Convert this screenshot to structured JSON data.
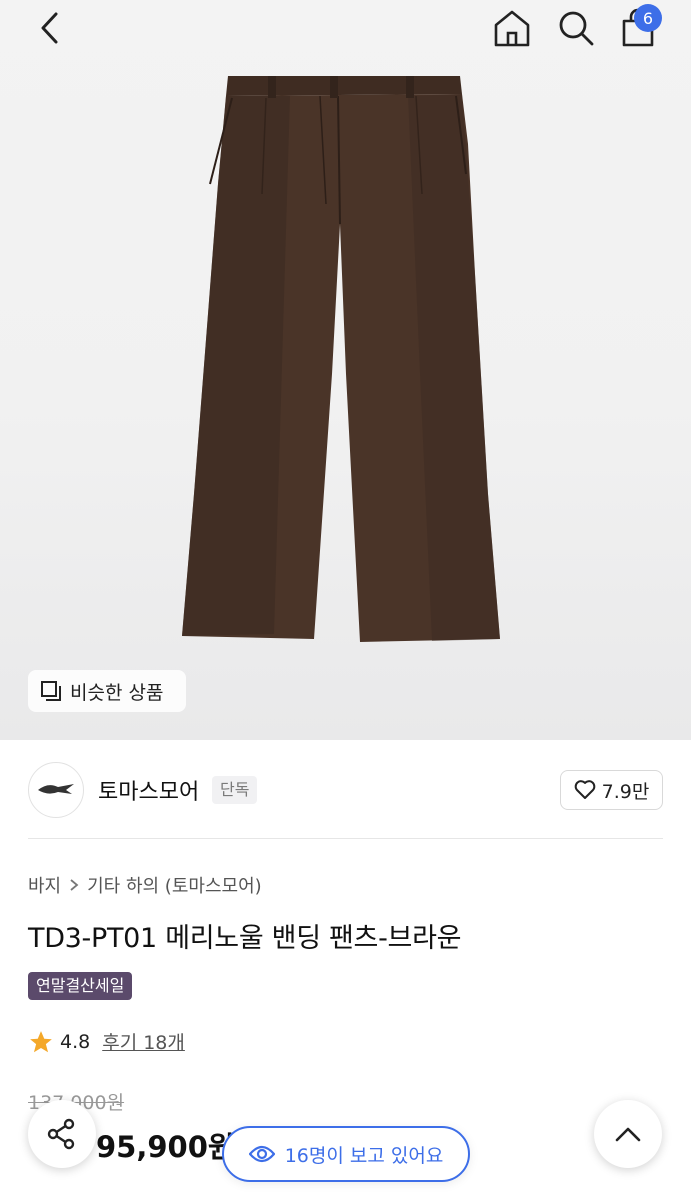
{
  "header": {
    "cart_count": "6"
  },
  "hero": {
    "similar_label": "비슷한 상품"
  },
  "brand": {
    "name": "토마스모어",
    "tag": "단독",
    "likes": "7.9만"
  },
  "product": {
    "breadcrumb": [
      "바지",
      "기타 하의 (토마스모어)"
    ],
    "title": "TD3-PT01 메리노울 밴딩 팬츠-브라운",
    "promo": "연말결산세일",
    "rating": "4.8",
    "review_label": "후기 18개",
    "original_price": "137,000원",
    "sale_price": "95,900원"
  },
  "floating": {
    "viewers": "16명이 보고 있어요"
  },
  "colors": {
    "accent": "#3d6ee8",
    "promo_bg": "#5b4a6b",
    "star": "#f4a82a",
    "pants": "#4a3428"
  },
  "icons": [
    "back-icon",
    "home-icon",
    "search-icon",
    "cart-icon",
    "similar-icon",
    "heart-icon",
    "star-icon",
    "share-icon",
    "eye-icon",
    "chevron-up-icon"
  ]
}
